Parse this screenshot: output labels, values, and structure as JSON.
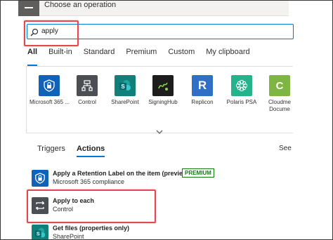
{
  "header": {
    "title": "Choose an operation"
  },
  "search": {
    "value": "apply"
  },
  "filter_tabs": [
    "All",
    "Built-in",
    "Standard",
    "Premium",
    "Custom",
    "My clipboard"
  ],
  "connectors": [
    {
      "label": "Microsoft 365 ...",
      "icon": "shield-lock-icon",
      "color": "#0f62b7"
    },
    {
      "label": "Control",
      "icon": "control-flow-icon",
      "color": "#4b4f54"
    },
    {
      "label": "SharePoint",
      "icon": "sharepoint-icon",
      "color": "#117f7a"
    },
    {
      "label": "SigningHub",
      "icon": "signinghub-icon",
      "color": "#1d1d1d"
    },
    {
      "label": "Replicon",
      "icon": "replicon-icon",
      "color": "#2f6fc6"
    },
    {
      "label": "Polaris PSA",
      "icon": "polaris-icon",
      "color": "#24b38a"
    },
    {
      "label": "Cloudme",
      "label2": "Docume",
      "icon": "cloudme-icon",
      "color": "#7fb542"
    }
  ],
  "sub_tabs": [
    "Triggers",
    "Actions"
  ],
  "see_more": "See",
  "actions": [
    {
      "title": "Apply a Retention Label on the item (preview)",
      "subtitle": "Microsoft 365 compliance",
      "badge": "PREMIUM",
      "icon": "shield-lock-icon",
      "color": "#0f62b7"
    },
    {
      "title": "Apply to each",
      "subtitle": "Control",
      "icon": "loop-icon",
      "color": "#4b4f54"
    },
    {
      "title": "Get files (properties only)",
      "subtitle": "SharePoint",
      "icon": "sharepoint-icon",
      "color": "#117f7a"
    }
  ],
  "colors": {
    "accent": "#0078d4",
    "highlight": "#e3484f",
    "premium": "#107c10"
  }
}
